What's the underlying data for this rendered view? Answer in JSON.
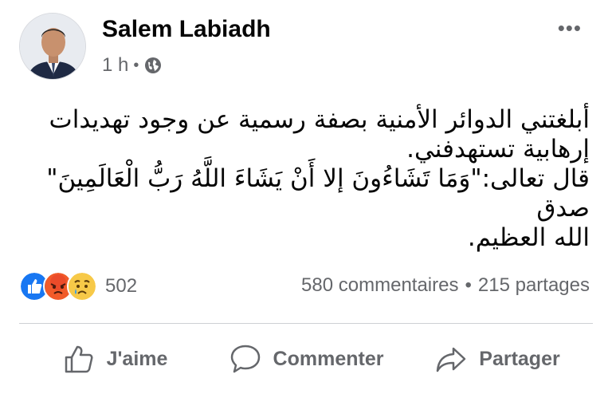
{
  "post": {
    "author": "Salem Labiadh",
    "time": "1 h",
    "separator": "•",
    "privacy_icon": "globe-icon",
    "more_label": "•••",
    "text_lines": [
      "أبلغتني الدوائر الأمنية بصفة رسمية عن وجود تهديدات",
      "إرهابية تستهدفني.",
      "قال تعالى:\"وَمَا تَشَاءُونَ إلا أَنْ يَشَاءَ اللَّهُ رَبُّ الْعَالَمِينَ\" صدق",
      "الله العظيم."
    ]
  },
  "stats": {
    "reaction_icons": [
      "like-icon",
      "angry-icon",
      "sad-icon"
    ],
    "reaction_count": "502",
    "comments": "580 commentaires",
    "separator": "•",
    "shares": "215 partages"
  },
  "actions": {
    "like_label": "J'aime",
    "comment_label": "Commenter",
    "share_label": "Partager"
  },
  "colors": {
    "like_blue": "#1877f2",
    "angry_orange": "#f15b2a",
    "sad_yellow": "#f7c948",
    "secondary_text": "#65676b"
  }
}
